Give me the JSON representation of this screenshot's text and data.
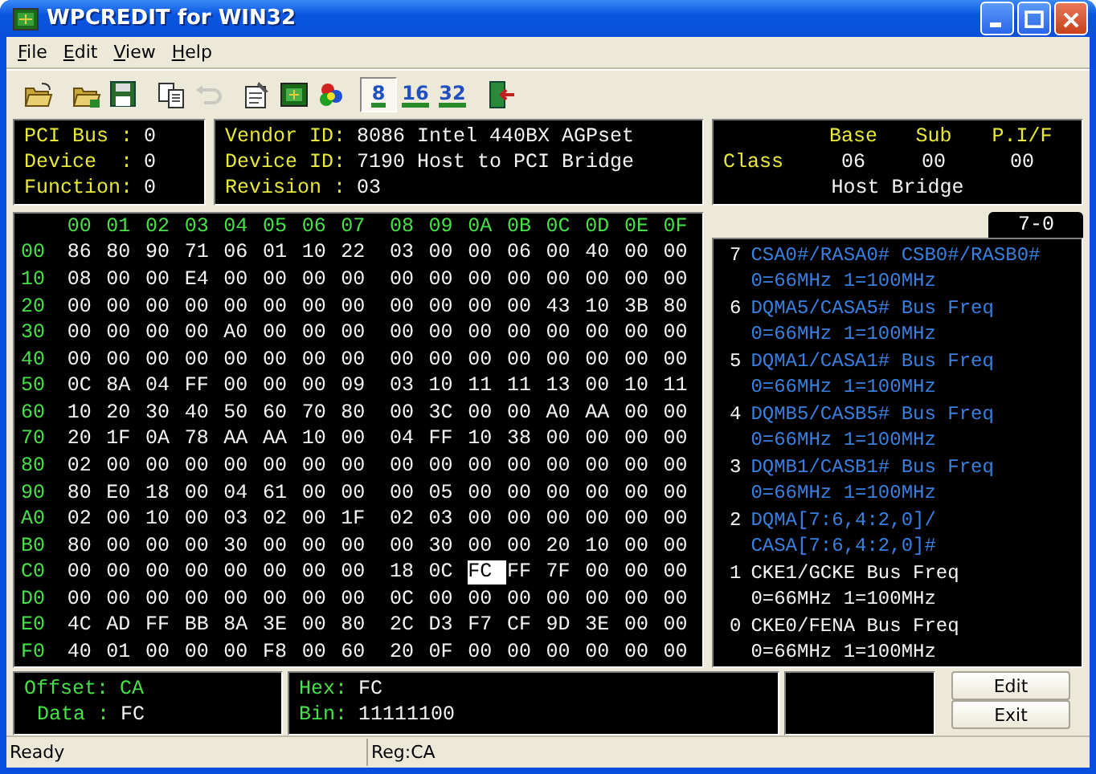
{
  "window": {
    "title": "WPCREDIT for WIN32"
  },
  "menu": [
    {
      "label": "File"
    },
    {
      "label": "Edit"
    },
    {
      "label": "View"
    },
    {
      "label": "Help"
    }
  ],
  "toolbar": [
    {
      "items": [
        {
          "kind": "open-folder",
          "disabled": false,
          "pressed": false
        }
      ]
    },
    {
      "items": [
        {
          "kind": "save-folder",
          "disabled": false,
          "pressed": false
        },
        {
          "kind": "floppy",
          "disabled": false,
          "pressed": false
        }
      ]
    },
    {
      "items": [
        {
          "kind": "copy",
          "disabled": false,
          "pressed": false
        },
        {
          "kind": "undo",
          "disabled": true,
          "pressed": false
        }
      ]
    },
    {
      "items": [
        {
          "kind": "properties",
          "disabled": false,
          "pressed": false
        },
        {
          "kind": "board",
          "disabled": false,
          "pressed": false
        },
        {
          "kind": "balls",
          "disabled": false,
          "pressed": false
        }
      ]
    },
    {
      "items": [
        {
          "kind": "width",
          "label": "8",
          "disabled": false,
          "pressed": true
        },
        {
          "kind": "width",
          "label": "16",
          "disabled": false,
          "pressed": false
        },
        {
          "kind": "width",
          "label": "32",
          "disabled": false,
          "pressed": false
        }
      ]
    },
    {
      "items": [
        {
          "kind": "exit-door",
          "disabled": false,
          "pressed": false
        }
      ]
    }
  ],
  "location": [
    {
      "label": "PCI Bus :",
      "value": "0"
    },
    {
      "label": "Device  :",
      "value": "0"
    },
    {
      "label": "Function:",
      "value": "0"
    }
  ],
  "device": [
    {
      "label": "Vendor ID:",
      "value": "8086 Intel 440BX AGPset"
    },
    {
      "label": "Device ID:",
      "value": "7190 Host to PCI Bridge"
    },
    {
      "label": "Revision :",
      "value": "03"
    }
  ],
  "class": {
    "headers": [
      "Base",
      "Sub",
      "P.I/F"
    ],
    "label": "Class",
    "values": [
      "06",
      "00",
      "00"
    ],
    "name": "Host Bridge"
  },
  "hex": {
    "columns": [
      "00",
      "01",
      "02",
      "03",
      "04",
      "05",
      "06",
      "07",
      "08",
      "09",
      "0A",
      "0B",
      "0C",
      "0D",
      "0E",
      "0F"
    ],
    "rows": [
      {
        "label": "00",
        "cells": [
          {
            "v": "86",
            "selected": false
          },
          {
            "v": "80",
            "selected": false
          },
          {
            "v": "90",
            "selected": false
          },
          {
            "v": "71",
            "selected": false
          },
          {
            "v": "06",
            "selected": false
          },
          {
            "v": "01",
            "selected": false
          },
          {
            "v": "10",
            "selected": false
          },
          {
            "v": "22",
            "selected": false
          },
          {
            "v": "03",
            "selected": false
          },
          {
            "v": "00",
            "selected": false
          },
          {
            "v": "00",
            "selected": false
          },
          {
            "v": "06",
            "selected": false
          },
          {
            "v": "00",
            "selected": false
          },
          {
            "v": "40",
            "selected": false
          },
          {
            "v": "00",
            "selected": false
          },
          {
            "v": "00",
            "selected": false
          }
        ]
      },
      {
        "label": "10",
        "cells": [
          {
            "v": "08",
            "selected": false
          },
          {
            "v": "00",
            "selected": false
          },
          {
            "v": "00",
            "selected": false
          },
          {
            "v": "E4",
            "selected": false
          },
          {
            "v": "00",
            "selected": false
          },
          {
            "v": "00",
            "selected": false
          },
          {
            "v": "00",
            "selected": false
          },
          {
            "v": "00",
            "selected": false
          },
          {
            "v": "00",
            "selected": false
          },
          {
            "v": "00",
            "selected": false
          },
          {
            "v": "00",
            "selected": false
          },
          {
            "v": "00",
            "selected": false
          },
          {
            "v": "00",
            "selected": false
          },
          {
            "v": "00",
            "selected": false
          },
          {
            "v": "00",
            "selected": false
          },
          {
            "v": "00",
            "selected": false
          }
        ]
      },
      {
        "label": "20",
        "cells": [
          {
            "v": "00",
            "selected": false
          },
          {
            "v": "00",
            "selected": false
          },
          {
            "v": "00",
            "selected": false
          },
          {
            "v": "00",
            "selected": false
          },
          {
            "v": "00",
            "selected": false
          },
          {
            "v": "00",
            "selected": false
          },
          {
            "v": "00",
            "selected": false
          },
          {
            "v": "00",
            "selected": false
          },
          {
            "v": "00",
            "selected": false
          },
          {
            "v": "00",
            "selected": false
          },
          {
            "v": "00",
            "selected": false
          },
          {
            "v": "00",
            "selected": false
          },
          {
            "v": "43",
            "selected": false
          },
          {
            "v": "10",
            "selected": false
          },
          {
            "v": "3B",
            "selected": false
          },
          {
            "v": "80",
            "selected": false
          }
        ]
      },
      {
        "label": "30",
        "cells": [
          {
            "v": "00",
            "selected": false
          },
          {
            "v": "00",
            "selected": false
          },
          {
            "v": "00",
            "selected": false
          },
          {
            "v": "00",
            "selected": false
          },
          {
            "v": "A0",
            "selected": false
          },
          {
            "v": "00",
            "selected": false
          },
          {
            "v": "00",
            "selected": false
          },
          {
            "v": "00",
            "selected": false
          },
          {
            "v": "00",
            "selected": false
          },
          {
            "v": "00",
            "selected": false
          },
          {
            "v": "00",
            "selected": false
          },
          {
            "v": "00",
            "selected": false
          },
          {
            "v": "00",
            "selected": false
          },
          {
            "v": "00",
            "selected": false
          },
          {
            "v": "00",
            "selected": false
          },
          {
            "v": "00",
            "selected": false
          }
        ]
      },
      {
        "label": "40",
        "cells": [
          {
            "v": "00",
            "selected": false
          },
          {
            "v": "00",
            "selected": false
          },
          {
            "v": "00",
            "selected": false
          },
          {
            "v": "00",
            "selected": false
          },
          {
            "v": "00",
            "selected": false
          },
          {
            "v": "00",
            "selected": false
          },
          {
            "v": "00",
            "selected": false
          },
          {
            "v": "00",
            "selected": false
          },
          {
            "v": "00",
            "selected": false
          },
          {
            "v": "00",
            "selected": false
          },
          {
            "v": "00",
            "selected": false
          },
          {
            "v": "00",
            "selected": false
          },
          {
            "v": "00",
            "selected": false
          },
          {
            "v": "00",
            "selected": false
          },
          {
            "v": "00",
            "selected": false
          },
          {
            "v": "00",
            "selected": false
          }
        ]
      },
      {
        "label": "50",
        "cells": [
          {
            "v": "0C",
            "selected": false
          },
          {
            "v": "8A",
            "selected": false
          },
          {
            "v": "04",
            "selected": false
          },
          {
            "v": "FF",
            "selected": false
          },
          {
            "v": "00",
            "selected": false
          },
          {
            "v": "00",
            "selected": false
          },
          {
            "v": "00",
            "selected": false
          },
          {
            "v": "09",
            "selected": false
          },
          {
            "v": "03",
            "selected": false
          },
          {
            "v": "10",
            "selected": false
          },
          {
            "v": "11",
            "selected": false
          },
          {
            "v": "11",
            "selected": false
          },
          {
            "v": "13",
            "selected": false
          },
          {
            "v": "00",
            "selected": false
          },
          {
            "v": "10",
            "selected": false
          },
          {
            "v": "11",
            "selected": false
          }
        ]
      },
      {
        "label": "60",
        "cells": [
          {
            "v": "10",
            "selected": false
          },
          {
            "v": "20",
            "selected": false
          },
          {
            "v": "30",
            "selected": false
          },
          {
            "v": "40",
            "selected": false
          },
          {
            "v": "50",
            "selected": false
          },
          {
            "v": "60",
            "selected": false
          },
          {
            "v": "70",
            "selected": false
          },
          {
            "v": "80",
            "selected": false
          },
          {
            "v": "00",
            "selected": false
          },
          {
            "v": "3C",
            "selected": false
          },
          {
            "v": "00",
            "selected": false
          },
          {
            "v": "00",
            "selected": false
          },
          {
            "v": "A0",
            "selected": false
          },
          {
            "v": "AA",
            "selected": false
          },
          {
            "v": "00",
            "selected": false
          },
          {
            "v": "00",
            "selected": false
          }
        ]
      },
      {
        "label": "70",
        "cells": [
          {
            "v": "20",
            "selected": false
          },
          {
            "v": "1F",
            "selected": false
          },
          {
            "v": "0A",
            "selected": false
          },
          {
            "v": "78",
            "selected": false
          },
          {
            "v": "AA",
            "selected": false
          },
          {
            "v": "AA",
            "selected": false
          },
          {
            "v": "10",
            "selected": false
          },
          {
            "v": "00",
            "selected": false
          },
          {
            "v": "04",
            "selected": false
          },
          {
            "v": "FF",
            "selected": false
          },
          {
            "v": "10",
            "selected": false
          },
          {
            "v": "38",
            "selected": false
          },
          {
            "v": "00",
            "selected": false
          },
          {
            "v": "00",
            "selected": false
          },
          {
            "v": "00",
            "selected": false
          },
          {
            "v": "00",
            "selected": false
          }
        ]
      },
      {
        "label": "80",
        "cells": [
          {
            "v": "02",
            "selected": false
          },
          {
            "v": "00",
            "selected": false
          },
          {
            "v": "00",
            "selected": false
          },
          {
            "v": "00",
            "selected": false
          },
          {
            "v": "00",
            "selected": false
          },
          {
            "v": "00",
            "selected": false
          },
          {
            "v": "00",
            "selected": false
          },
          {
            "v": "00",
            "selected": false
          },
          {
            "v": "00",
            "selected": false
          },
          {
            "v": "00",
            "selected": false
          },
          {
            "v": "00",
            "selected": false
          },
          {
            "v": "00",
            "selected": false
          },
          {
            "v": "00",
            "selected": false
          },
          {
            "v": "00",
            "selected": false
          },
          {
            "v": "00",
            "selected": false
          },
          {
            "v": "00",
            "selected": false
          }
        ]
      },
      {
        "label": "90",
        "cells": [
          {
            "v": "80",
            "selected": false
          },
          {
            "v": "E0",
            "selected": false
          },
          {
            "v": "18",
            "selected": false
          },
          {
            "v": "00",
            "selected": false
          },
          {
            "v": "04",
            "selected": false
          },
          {
            "v": "61",
            "selected": false
          },
          {
            "v": "00",
            "selected": false
          },
          {
            "v": "00",
            "selected": false
          },
          {
            "v": "00",
            "selected": false
          },
          {
            "v": "05",
            "selected": false
          },
          {
            "v": "00",
            "selected": false
          },
          {
            "v": "00",
            "selected": false
          },
          {
            "v": "00",
            "selected": false
          },
          {
            "v": "00",
            "selected": false
          },
          {
            "v": "00",
            "selected": false
          },
          {
            "v": "00",
            "selected": false
          }
        ]
      },
      {
        "label": "A0",
        "cells": [
          {
            "v": "02",
            "selected": false
          },
          {
            "v": "00",
            "selected": false
          },
          {
            "v": "10",
            "selected": false
          },
          {
            "v": "00",
            "selected": false
          },
          {
            "v": "03",
            "selected": false
          },
          {
            "v": "02",
            "selected": false
          },
          {
            "v": "00",
            "selected": false
          },
          {
            "v": "1F",
            "selected": false
          },
          {
            "v": "02",
            "selected": false
          },
          {
            "v": "03",
            "selected": false
          },
          {
            "v": "00",
            "selected": false
          },
          {
            "v": "00",
            "selected": false
          },
          {
            "v": "00",
            "selected": false
          },
          {
            "v": "00",
            "selected": false
          },
          {
            "v": "00",
            "selected": false
          },
          {
            "v": "00",
            "selected": false
          }
        ]
      },
      {
        "label": "B0",
        "cells": [
          {
            "v": "80",
            "selected": false
          },
          {
            "v": "00",
            "selected": false
          },
          {
            "v": "00",
            "selected": false
          },
          {
            "v": "00",
            "selected": false
          },
          {
            "v": "30",
            "selected": false
          },
          {
            "v": "00",
            "selected": false
          },
          {
            "v": "00",
            "selected": false
          },
          {
            "v": "00",
            "selected": false
          },
          {
            "v": "00",
            "selected": false
          },
          {
            "v": "30",
            "selected": false
          },
          {
            "v": "00",
            "selected": false
          },
          {
            "v": "00",
            "selected": false
          },
          {
            "v": "20",
            "selected": false
          },
          {
            "v": "10",
            "selected": false
          },
          {
            "v": "00",
            "selected": false
          },
          {
            "v": "00",
            "selected": false
          }
        ]
      },
      {
        "label": "C0",
        "cells": [
          {
            "v": "00",
            "selected": false
          },
          {
            "v": "00",
            "selected": false
          },
          {
            "v": "00",
            "selected": false
          },
          {
            "v": "00",
            "selected": false
          },
          {
            "v": "00",
            "selected": false
          },
          {
            "v": "00",
            "selected": false
          },
          {
            "v": "00",
            "selected": false
          },
          {
            "v": "00",
            "selected": false
          },
          {
            "v": "18",
            "selected": false
          },
          {
            "v": "0C",
            "selected": false
          },
          {
            "v": "FC",
            "selected": true
          },
          {
            "v": "FF",
            "selected": false
          },
          {
            "v": "7F",
            "selected": false
          },
          {
            "v": "00",
            "selected": false
          },
          {
            "v": "00",
            "selected": false
          },
          {
            "v": "00",
            "selected": false
          }
        ]
      },
      {
        "label": "D0",
        "cells": [
          {
            "v": "00",
            "selected": false
          },
          {
            "v": "00",
            "selected": false
          },
          {
            "v": "00",
            "selected": false
          },
          {
            "v": "00",
            "selected": false
          },
          {
            "v": "00",
            "selected": false
          },
          {
            "v": "00",
            "selected": false
          },
          {
            "v": "00",
            "selected": false
          },
          {
            "v": "00",
            "selected": false
          },
          {
            "v": "0C",
            "selected": false
          },
          {
            "v": "00",
            "selected": false
          },
          {
            "v": "00",
            "selected": false
          },
          {
            "v": "00",
            "selected": false
          },
          {
            "v": "00",
            "selected": false
          },
          {
            "v": "00",
            "selected": false
          },
          {
            "v": "00",
            "selected": false
          },
          {
            "v": "00",
            "selected": false
          }
        ]
      },
      {
        "label": "E0",
        "cells": [
          {
            "v": "4C",
            "selected": false
          },
          {
            "v": "AD",
            "selected": false
          },
          {
            "v": "FF",
            "selected": false
          },
          {
            "v": "BB",
            "selected": false
          },
          {
            "v": "8A",
            "selected": false
          },
          {
            "v": "3E",
            "selected": false
          },
          {
            "v": "00",
            "selected": false
          },
          {
            "v": "80",
            "selected": false
          },
          {
            "v": "2C",
            "selected": false
          },
          {
            "v": "D3",
            "selected": false
          },
          {
            "v": "F7",
            "selected": false
          },
          {
            "v": "CF",
            "selected": false
          },
          {
            "v": "9D",
            "selected": false
          },
          {
            "v": "3E",
            "selected": false
          },
          {
            "v": "00",
            "selected": false
          },
          {
            "v": "00",
            "selected": false
          }
        ]
      },
      {
        "label": "F0",
        "cells": [
          {
            "v": "40",
            "selected": false
          },
          {
            "v": "01",
            "selected": false
          },
          {
            "v": "00",
            "selected": false
          },
          {
            "v": "00",
            "selected": false
          },
          {
            "v": "00",
            "selected": false
          },
          {
            "v": "F8",
            "selected": false
          },
          {
            "v": "00",
            "selected": false
          },
          {
            "v": "60",
            "selected": false
          },
          {
            "v": "20",
            "selected": false
          },
          {
            "v": "0F",
            "selected": false
          },
          {
            "v": "00",
            "selected": false
          },
          {
            "v": "00",
            "selected": false
          },
          {
            "v": "00",
            "selected": false
          },
          {
            "v": "00",
            "selected": false
          },
          {
            "v": "00",
            "selected": false
          },
          {
            "v": "00",
            "selected": false
          }
        ]
      }
    ]
  },
  "bits": {
    "tab": {
      "label": "7-0",
      "selected": true
    },
    "items": [
      {
        "bit": "7",
        "lines": [
          "CSA0#/RASA0# CSB0#/RASB0#",
          "0=66MHz 1=100MHz"
        ],
        "set": true
      },
      {
        "bit": "6",
        "lines": [
          "DQMA5/CASA5# Bus Freq",
          "0=66MHz 1=100MHz"
        ],
        "set": true
      },
      {
        "bit": "5",
        "lines": [
          "DQMA1/CASA1# Bus Freq",
          "0=66MHz 1=100MHz"
        ],
        "set": true
      },
      {
        "bit": "4",
        "lines": [
          "DQMB5/CASB5# Bus Freq",
          "0=66MHz 1=100MHz"
        ],
        "set": true
      },
      {
        "bit": "3",
        "lines": [
          "DQMB1/CASB1# Bus Freq",
          "0=66MHz 1=100MHz"
        ],
        "set": true
      },
      {
        "bit": "2",
        "lines": [
          "DQMA[7:6,4:2,0]/",
          "CASA[7:6,4:2,0]#"
        ],
        "set": true
      },
      {
        "bit": "1",
        "lines": [
          "CKE1/GCKE Bus Freq",
          "0=66MHz 1=100MHz"
        ],
        "set": false
      },
      {
        "bit": "0",
        "lines": [
          "CKE0/FENA Bus Freq",
          "0=66MHz 1=100MHz"
        ],
        "set": false
      }
    ]
  },
  "offset": {
    "offset_label": "Offset:",
    "offset": "CA",
    "data_label": "Data :",
    "data": "FC"
  },
  "value": {
    "hex_label": "Hex:",
    "hex": "FC",
    "bin_label": "Bin:",
    "bin": "11111100"
  },
  "buttons": [
    "Edit",
    "Exit"
  ],
  "status_bar": [
    "Ready",
    "Reg:CA"
  ]
}
